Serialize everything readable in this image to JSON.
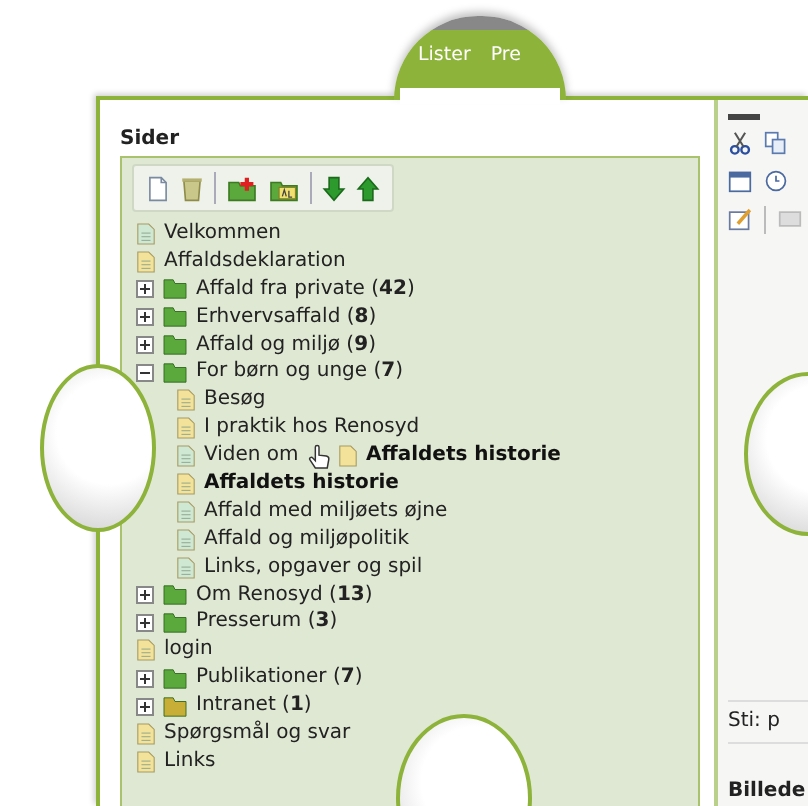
{
  "tabs": [
    "Lister",
    "Pre"
  ],
  "pages_panel": {
    "title": "Sider"
  },
  "tree": [
    {
      "kind": "page",
      "label": "Velkommen",
      "color": "#cfe8d4",
      "selected": false
    },
    {
      "kind": "page",
      "label": "Affaldsdeklaration",
      "color": "#f3e39a",
      "selected": false
    },
    {
      "kind": "folder",
      "label": "Affald fra private (**42**)",
      "color": "#5ba83c",
      "expanded": false,
      "selected": false
    },
    {
      "kind": "folder",
      "label": "Erhvervsaffald (**8**)",
      "color": "#5ba83c",
      "expanded": false,
      "selected": false
    },
    {
      "kind": "folder",
      "label": "Affald og miljø (**9**)",
      "color": "#5ba83c",
      "expanded": false,
      "selected": false
    },
    {
      "kind": "folder",
      "label": "For børn og unge (**7**)",
      "color": "#5ba83c",
      "expanded": true,
      "selected": false,
      "children": [
        {
          "kind": "page",
          "label": "Besøg",
          "color": "#f3e39a",
          "selected": false
        },
        {
          "kind": "page",
          "label": "I praktik hos Renosyd",
          "color": "#f3e39a",
          "selected": false
        },
        {
          "kind": "page",
          "label": "Viden om",
          "color": "#cfe8d4",
          "selected": false
        },
        {
          "kind": "page",
          "label": "Affaldets historie",
          "color": "#f3e39a",
          "selected": true
        },
        {
          "kind": "page",
          "label": "Affald med miljøets øjne",
          "color": "#cfe8d4",
          "selected": false
        },
        {
          "kind": "page",
          "label": "Affald og miljøpolitik",
          "color": "#cfe8d4",
          "selected": false
        },
        {
          "kind": "page",
          "label": "Links, opgaver og spil",
          "color": "#cfe8d4",
          "selected": false
        }
      ]
    },
    {
      "kind": "folder",
      "label": "Om Renosyd (**13**)",
      "color": "#5ba83c",
      "expanded": false,
      "selected": false
    },
    {
      "kind": "folder",
      "label": "Presserum (**3**)",
      "color": "#5ba83c",
      "expanded": false,
      "selected": false
    },
    {
      "kind": "page",
      "label": "login",
      "color": "#f3e39a",
      "selected": false
    },
    {
      "kind": "folder",
      "label": "Publikationer (**7**)",
      "color": "#5ba83c",
      "expanded": false,
      "selected": false
    },
    {
      "kind": "folder",
      "label": "Intranet (**1**)",
      "color": "#c8ae36",
      "expanded": false,
      "selected": false
    },
    {
      "kind": "page",
      "label": "Spørgsmål og svar",
      "color": "#f3e39a",
      "selected": false
    },
    {
      "kind": "page",
      "label": "Links",
      "color": "#f3e39a",
      "selected": false
    }
  ],
  "drag_ghost": {
    "label": "Affaldets historie"
  },
  "editor_panel": {
    "path_label": "Sti: p",
    "section_title": "Billede"
  }
}
